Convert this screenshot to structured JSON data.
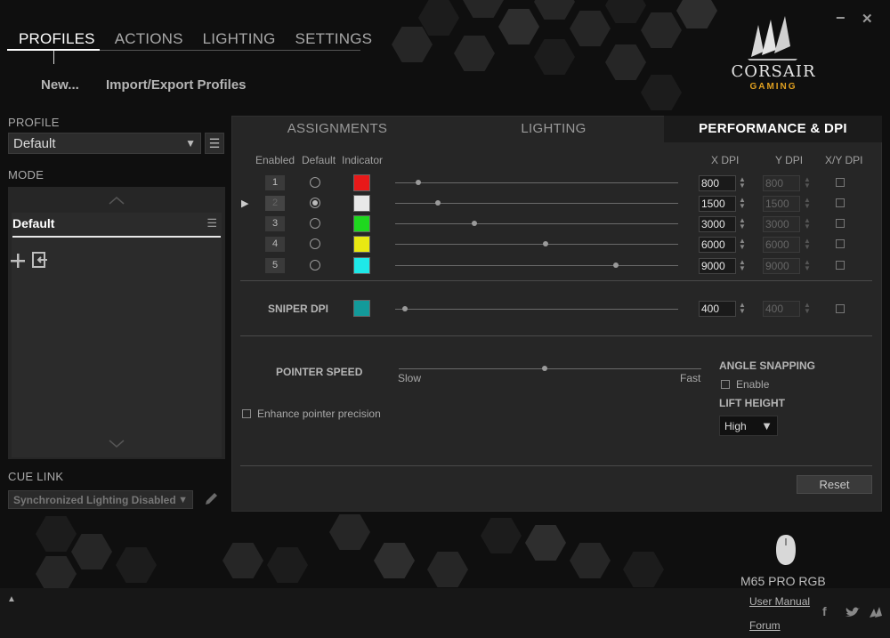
{
  "nav": {
    "tabs": [
      "PROFILES",
      "ACTIONS",
      "LIGHTING",
      "SETTINGS"
    ],
    "new_label": "New...",
    "import_export_label": "Import/Export Profiles"
  },
  "window": {
    "minimize": "−",
    "close": "✕"
  },
  "brand": {
    "name": "CORSAIR",
    "sub": "GAMING"
  },
  "left": {
    "profile_label": "PROFILE",
    "profile_value": "Default",
    "mode_label": "MODE",
    "mode_item": "Default",
    "cue_link_label": "CUE LINK",
    "cue_link_value": "Synchronized Lighting Disabled"
  },
  "panel": {
    "tabs": [
      "ASSIGNMENTS",
      "LIGHTING",
      "PERFORMANCE & DPI"
    ],
    "headers": {
      "enabled": "Enabled",
      "default": "Default",
      "indicator": "Indicator",
      "xdpi": "X DPI",
      "ydpi": "Y DPI",
      "xydpi": "X/Y DPI"
    },
    "rows": [
      {
        "index": "1",
        "color": "#e81919",
        "x": "800",
        "y": "800",
        "slider": 0.04,
        "default": false,
        "selected": false
      },
      {
        "index": "2",
        "color": "#e8e8e8",
        "x": "1500",
        "y": "1500",
        "slider": 0.11,
        "default": true,
        "selected": true
      },
      {
        "index": "3",
        "color": "#1ed81e",
        "x": "3000",
        "y": "3000",
        "slider": 0.24,
        "default": false,
        "selected": false
      },
      {
        "index": "4",
        "color": "#e8e812",
        "x": "6000",
        "y": "6000",
        "slider": 0.49,
        "default": false,
        "selected": false
      },
      {
        "index": "5",
        "color": "#1ee8e8",
        "x": "9000",
        "y": "9000",
        "slider": 0.74,
        "default": false,
        "selected": false
      }
    ],
    "sniper": {
      "label": "SNIPER DPI",
      "color": "#139a9a",
      "x": "400",
      "y": "400",
      "slider": 0.02
    },
    "pointer": {
      "label": "POINTER SPEED",
      "slow": "Slow",
      "fast": "Fast",
      "value": 0.47,
      "enhance_label": "Enhance pointer precision"
    },
    "angle": {
      "label": "ANGLE SNAPPING",
      "enable_label": "Enable"
    },
    "lift": {
      "label": "LIFT HEIGHT",
      "value": "High"
    },
    "reset_label": "Reset"
  },
  "device": {
    "name": "M65 PRO RGB"
  },
  "footer": {
    "user_manual": "User Manual",
    "forum": "Forum",
    "social": [
      "f",
      "t",
      "c"
    ]
  }
}
